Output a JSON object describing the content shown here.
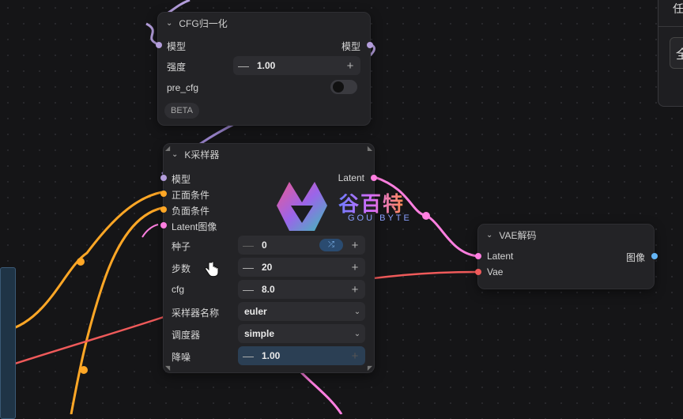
{
  "nodes": {
    "cfg_norm": {
      "title": "CFG归一化",
      "input_model": "模型",
      "output_model": "模型",
      "strength_label": "强度",
      "strength_value": "1.00",
      "pre_cfg_label": "pre_cfg",
      "badge": "BETA"
    },
    "ksampler": {
      "title": "K采样器",
      "inputs": [
        "模型",
        "正面条件",
        "负面条件",
        "Latent图像"
      ],
      "output": "Latent",
      "seed_label": "种子",
      "seed_value": "0",
      "steps_label": "步数",
      "steps_value": "20",
      "cfg_label": "cfg",
      "cfg_value": "8.0",
      "sampler_label": "采样器名称",
      "sampler_value": "euler",
      "scheduler_label": "调度器",
      "scheduler_value": "simple",
      "denoise_label": "降噪",
      "denoise_value": "1.00"
    },
    "vae_decode": {
      "title": "VAE解码",
      "input_latent": "Latent",
      "input_vae": "Vae",
      "output": "图像"
    }
  },
  "side_panel": {
    "glyph_top": "任",
    "glyph_box": "全"
  },
  "watermark": {
    "cn": "谷百特",
    "en": "GOU BYTE"
  },
  "colors": {
    "model": "#b39ddb",
    "conditioning": "#ffa726",
    "latent": "#ff7fe0",
    "vae": "#ff6b6b",
    "image": "#64b5f6"
  }
}
